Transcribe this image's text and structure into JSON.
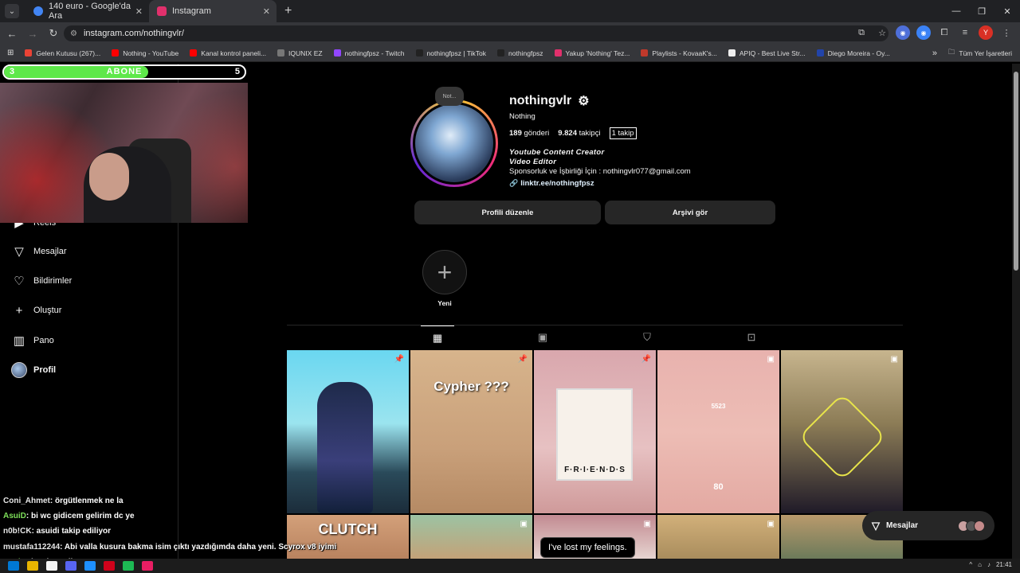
{
  "browser": {
    "tabs": [
      {
        "title": "140 euro - Google'da Ara",
        "color": "#4285f4"
      },
      {
        "title": "Instagram",
        "color": "#e1306c"
      }
    ],
    "url": "instagram.com/nothingvlr/",
    "bookmarks": [
      {
        "label": "Gelen Kutusu (267)...",
        "color": "#ea4335"
      },
      {
        "label": "Nothing - YouTube",
        "color": "#ff0000"
      },
      {
        "label": "Kanal kontrol paneli...",
        "color": "#ff0000"
      },
      {
        "label": "IQUNIX EZ",
        "color": "#777777"
      },
      {
        "label": "nothingfpsz - Twitch",
        "color": "#9146ff"
      },
      {
        "label": "nothingfpsz | TikTok",
        "color": "#222222"
      },
      {
        "label": "nothingfpsz",
        "color": "#222222"
      },
      {
        "label": "Yakup 'Nothing' Tez...",
        "color": "#e1306c"
      },
      {
        "label": "Playlists - KovaaK's...",
        "color": "#c0392b"
      },
      {
        "label": "APIQ - Best Live Str...",
        "color": "#eeeeee"
      },
      {
        "label": "Diego Moreira - Oy...",
        "color": "#2244aa"
      }
    ],
    "bookmarks_more": "»",
    "all_bookmarks": "Tüm Yer İşaretleri",
    "profile_letter": "Y"
  },
  "overlay": {
    "abone_label": "ABONE",
    "abone_current": "3",
    "abone_goal": "5",
    "abone_fraction": 0.6,
    "chat": [
      {
        "user": "Coni_Ahmet",
        "text": ": örgütlenmek ne la"
      },
      {
        "user": "AsuiD",
        "text": ": bi wc gidicem gelirim dc ye"
      },
      {
        "user": "n0b!CK",
        "text": ": asuidi takip ediliyor"
      },
      {
        "user": "mustafa112244",
        "text": ": Abi valla kusura bakma isim çıktı yazdığımda daha yeni. Scyrox v8 iyimi"
      },
      {
        "user": "AsuiD",
        "text": ": jaxvior geliyomu"
      }
    ]
  },
  "sidebar": {
    "items": [
      {
        "label": "Reels",
        "icon": "reels-icon"
      },
      {
        "label": "Mesajlar",
        "icon": "messages-icon"
      },
      {
        "label": "Bildirimler",
        "icon": "heart-icon"
      },
      {
        "label": "Oluştur",
        "icon": "plus-icon"
      },
      {
        "label": "Pano",
        "icon": "dashboard-icon"
      },
      {
        "label": "Profil",
        "icon": "profile-avatar"
      }
    ]
  },
  "profile": {
    "note": "Not...",
    "username": "nothingvlr",
    "fullname": "Nothing",
    "posts_count": "189",
    "posts_label": "gönderi",
    "followers_count": "9.824",
    "followers_label": "takipçi",
    "following_count": "1",
    "following_label": "takip",
    "bio_line1": "Youtube Content Creator",
    "bio_line2": "Video Editor",
    "bio_line3": "Sponsorluk ve İşbirliği İçin : nothingvlr077@gmail.com",
    "link": "linktr.ee/nothingfpsz",
    "edit_button": "Profili düzenle",
    "archive_button": "Arşivi gör",
    "highlight_label": "Yeni"
  },
  "grid": {
    "row1": [
      {
        "caption": "",
        "badge": "pin-icon",
        "bg": "linear-gradient(180deg,#6ad7f0 0%,#9be4ef 45%,#2a4a5a 75%,#1b2c3a 100%)"
      },
      {
        "caption": "Cypher ???",
        "badge": "pin-icon",
        "bg": "linear-gradient(180deg,#d7b48c 0%,#c9a07a 60%,#b58a64 100%)"
      },
      {
        "caption": "F·R·I·E·N·D·S",
        "badge": "pin-icon",
        "bg": "linear-gradient(180deg,#d9a7ad 0%,#e7c1c2 60%,#cf9a9a 100%)"
      },
      {
        "caption": "5523",
        "badge": "clip-icon",
        "bg": "linear-gradient(180deg,#e8b2ae 0%,#edbdb5 50%,#e3a9a2 100%)"
      },
      {
        "caption": "",
        "badge": "clip-icon",
        "bg": "linear-gradient(180deg,#c7b58e 0%,#8c7c56 45%,#1f1a28 100%)"
      }
    ],
    "row2": [
      {
        "caption": "CLUTCH",
        "bg": "linear-gradient(180deg,#d3a07a,#b9835f)"
      },
      {
        "caption": "",
        "bg": "linear-gradient(180deg,#9cc3a3,#c3a278)"
      },
      {
        "caption": "",
        "bg": "linear-gradient(180deg,#c28a91,#e6d4d0)"
      },
      {
        "caption": "",
        "bg": "linear-gradient(180deg,#d2b07a,#a98d5d)"
      },
      {
        "caption": "",
        "bg": "linear-gradient(180deg,#b99a6c,#6c7a5a)"
      }
    ],
    "extra_labels": {
      "kill_count": "80",
      "tooltip": "I've lost my feelings."
    }
  },
  "messages_pill": "Mesajlar",
  "taskbar": {
    "time": "21:41"
  }
}
